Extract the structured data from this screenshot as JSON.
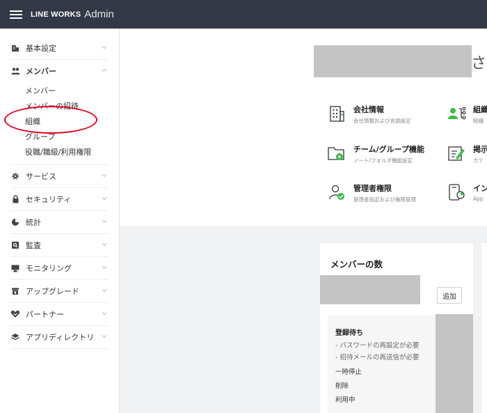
{
  "header": {
    "brand": "LINE WORKS",
    "brand_suffix": "Admin"
  },
  "sidebar": {
    "items": [
      {
        "label": "基本設定",
        "icon": "building-icon"
      },
      {
        "label": "メンバー",
        "icon": "members-icon",
        "expanded": true
      },
      {
        "label": "サービス",
        "icon": "gear-icon"
      },
      {
        "label": "セキュリティ",
        "icon": "lock-icon"
      },
      {
        "label": "統計",
        "icon": "pie-chart-icon"
      },
      {
        "label": "監査",
        "icon": "audit-icon"
      },
      {
        "label": "モニタリング",
        "icon": "monitor-icon"
      },
      {
        "label": "アップグレード",
        "icon": "upgrade-icon"
      },
      {
        "label": "パートナー",
        "icon": "handshake-icon"
      },
      {
        "label": "アプリディレクトリ",
        "icon": "layers-icon"
      }
    ],
    "member_subitems": [
      "メンバー",
      "メンバーの招待",
      "組織",
      "グループ",
      "役職/職級/利用権限"
    ]
  },
  "main": {
    "greeting": "さん",
    "quick_links": [
      {
        "title": "会社情報",
        "subtitle": "会社情報および言語設定",
        "icon": "company-info-icon"
      },
      {
        "title": "組織",
        "subtitle": "組織",
        "icon": "organization-icon"
      },
      {
        "title": "チーム/グループ機能",
        "subtitle": "ノート/フォルダ機能設定",
        "icon": "team-folder-icon"
      },
      {
        "title": "掲示",
        "subtitle": "カテ",
        "icon": "board-edit-icon"
      },
      {
        "title": "管理者権限",
        "subtitle": "管理者指定および権限管理",
        "icon": "admin-user-icon"
      },
      {
        "title": "イン",
        "subtitle": "App",
        "icon": "install-icon"
      }
    ],
    "member_card": {
      "title": "メンバーの数",
      "add_label": "追加",
      "status_heading": "登録待ち",
      "notes": [
        "- パスワードの再設定が必要",
        "- 招待メールの再送信が必要"
      ],
      "statuses": [
        "一時停止",
        "削除",
        "利用中"
      ]
    }
  },
  "colors": {
    "topbar": "#333846",
    "accent_green": "#3dba4e",
    "annotation_red": "#e3001b"
  }
}
